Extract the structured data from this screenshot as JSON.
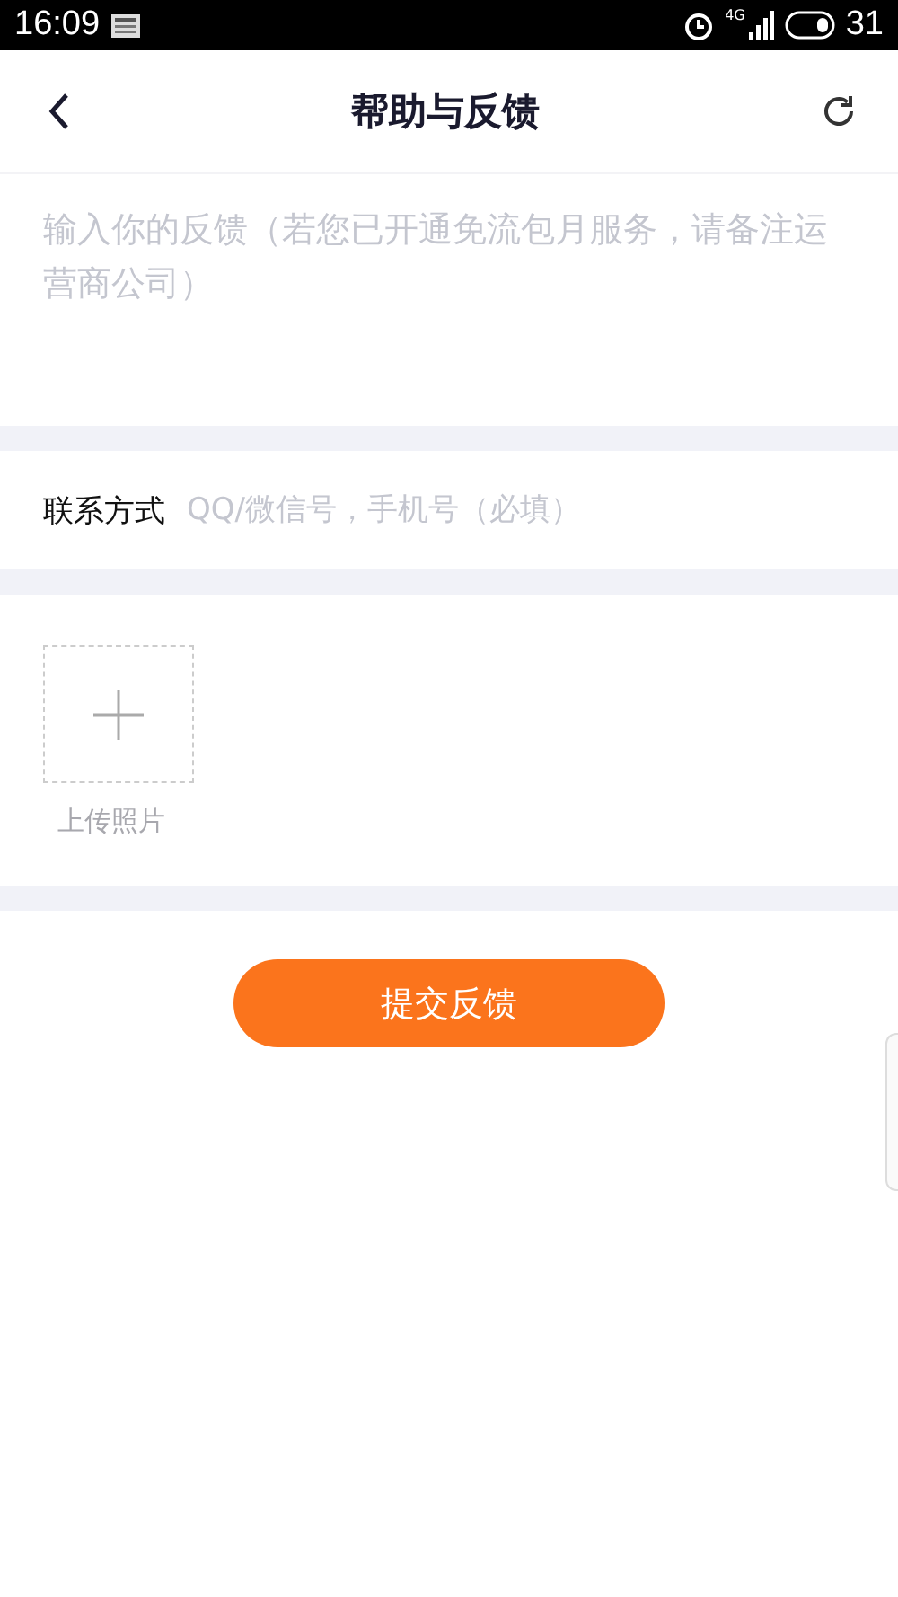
{
  "status_bar": {
    "time": "16:09",
    "network": "4G",
    "battery": "31"
  },
  "header": {
    "title": "帮助与反馈"
  },
  "feedback": {
    "placeholder": "输入你的反馈（若您已开通免流包月服务，请备注运营商公司）"
  },
  "contact": {
    "label": "联系方式",
    "placeholder": "QQ/微信号，手机号（必填）"
  },
  "upload": {
    "label": "上传照片"
  },
  "submit": {
    "label": "提交反馈"
  }
}
